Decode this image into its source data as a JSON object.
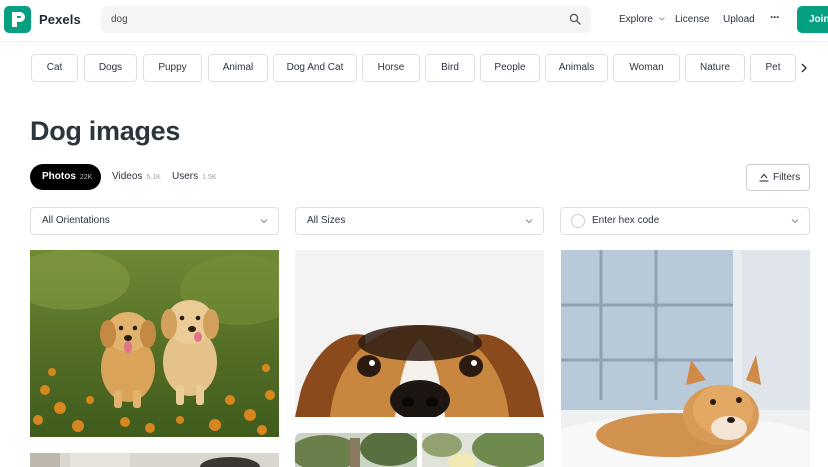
{
  "header": {
    "brand": "Pexels",
    "search": {
      "value": "dog",
      "placeholder": ""
    },
    "nav": {
      "explore": "Explore",
      "license": "License",
      "upload": "Upload",
      "more": "···"
    },
    "join_label": "Join"
  },
  "chips": [
    "Cat",
    "Dogs",
    "Puppy",
    "Animal",
    "Dog And Cat",
    "Horse",
    "Bird",
    "People",
    "Animals",
    "Woman",
    "Nature",
    "Pet"
  ],
  "page_title": "Dog images",
  "tabs": [
    {
      "label": "Photos",
      "count": "22K",
      "active": true
    },
    {
      "label": "Videos",
      "count": "5.1K",
      "active": false
    },
    {
      "label": "Users",
      "count": "1.5K",
      "active": false
    }
  ],
  "filters_label": "Filters",
  "dropdowns": {
    "orientation": "All Orientations",
    "size": "All Sizes",
    "color_placeholder": "Enter hex code"
  },
  "colors": {
    "brand": "#05a081",
    "active_tab": "#000000",
    "text": "#2c343e"
  }
}
